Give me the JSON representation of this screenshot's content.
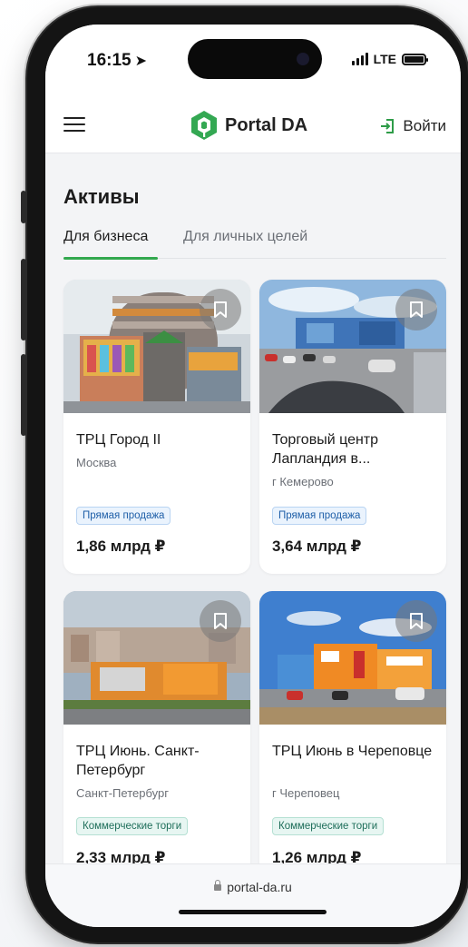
{
  "status_bar": {
    "time": "16:15",
    "network": "LTE"
  },
  "header": {
    "brand_name": "Portal DA",
    "login_label": "Войти",
    "icons": [
      "menu-icon",
      "portal-da-logo",
      "login-icon"
    ]
  },
  "page": {
    "title": "Активы",
    "tabs": [
      {
        "label": "Для бизнеса",
        "active": true
      },
      {
        "label": "Для личных целей",
        "active": false
      }
    ]
  },
  "listings": [
    {
      "title": "ТРЦ Город II",
      "city": "Москва",
      "badge": "Прямая продажа",
      "price": "1,86 млрд ₽"
    },
    {
      "title": "Торговый центр Лапландия в...",
      "city": "г Кемерово",
      "badge": "Прямая продажа",
      "price": "3,64 млрд ₽"
    },
    {
      "title": "ТРЦ Июнь. Санкт-Петербург",
      "city": "Санкт-Петербург",
      "badge": "Коммерческие торги",
      "price": "2,33 млрд ₽"
    },
    {
      "title": "ТРЦ Июнь в Череповце",
      "city": "г Череповец",
      "badge": "Коммерческие торги",
      "price": "1,26 млрд ₽"
    }
  ],
  "browser": {
    "url": "portal-da.ru"
  },
  "colors": {
    "accent_green": "#32a84e",
    "badge_blue": "#1f5fa8",
    "badge_teal": "#1e6e5a"
  }
}
